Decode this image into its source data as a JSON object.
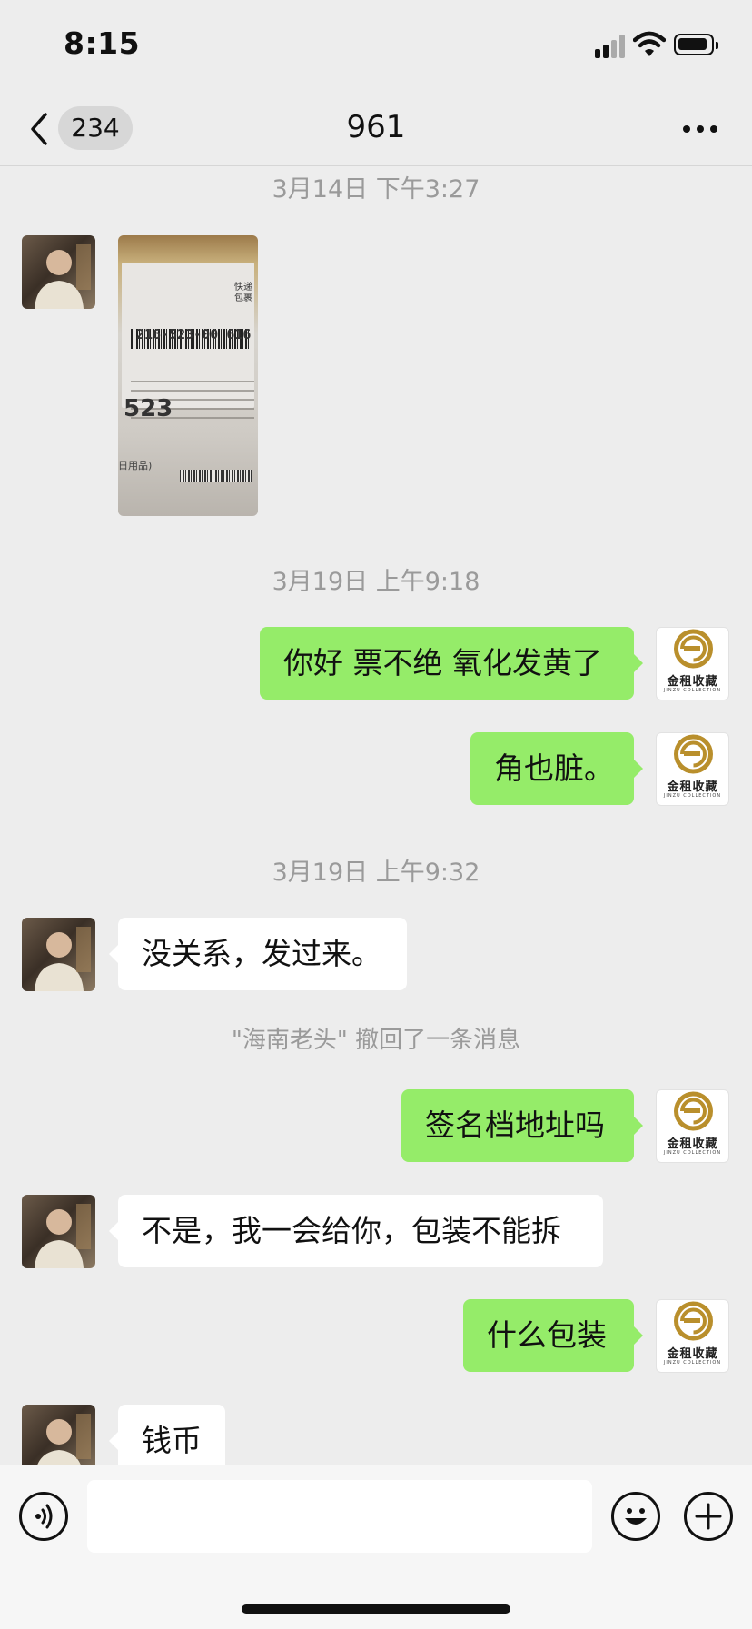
{
  "status_bar": {
    "time": "8:15"
  },
  "nav": {
    "back_badge": "234",
    "title": "961"
  },
  "messages": [
    {
      "type": "timestamp",
      "text": "3月14日 下午3:27"
    },
    {
      "type": "image",
      "side": "in",
      "label": {
        "tracking": "216-523-00 616",
        "code": "523",
        "tag1": "快递",
        "tag2": "包裹",
        "note": "日用品)"
      }
    },
    {
      "type": "timestamp",
      "text": "3月19日 上午9:18"
    },
    {
      "type": "text",
      "side": "out",
      "text": "你好 票不绝 氧化发黄了"
    },
    {
      "type": "text",
      "side": "out",
      "text": "角也脏。"
    },
    {
      "type": "timestamp",
      "text": "3月19日 上午9:32"
    },
    {
      "type": "text",
      "side": "in",
      "text": "没关系，发过来。"
    },
    {
      "type": "system",
      "text": "\"海南老头\" 撤回了一条消息"
    },
    {
      "type": "text",
      "side": "out",
      "text": "签名档地址吗"
    },
    {
      "type": "text",
      "side": "in",
      "text": "不是，我一会给你，包装不能拆"
    },
    {
      "type": "text",
      "side": "out",
      "text": "什么包装"
    },
    {
      "type": "text",
      "side": "in",
      "text": "钱币"
    }
  ],
  "my_avatar": {
    "brand": "金租收藏",
    "sub": "JINZU COLLECTION"
  },
  "input": {
    "value": ""
  },
  "colors": {
    "outgoing_bubble": "#95ec69",
    "incoming_bubble": "#ffffff",
    "background": "#ededed",
    "logo_gold": "#b98f2c"
  },
  "icons": [
    "back-chevron-icon",
    "more-dots-icon",
    "voice-icon",
    "emoji-icon",
    "plus-icon"
  ]
}
